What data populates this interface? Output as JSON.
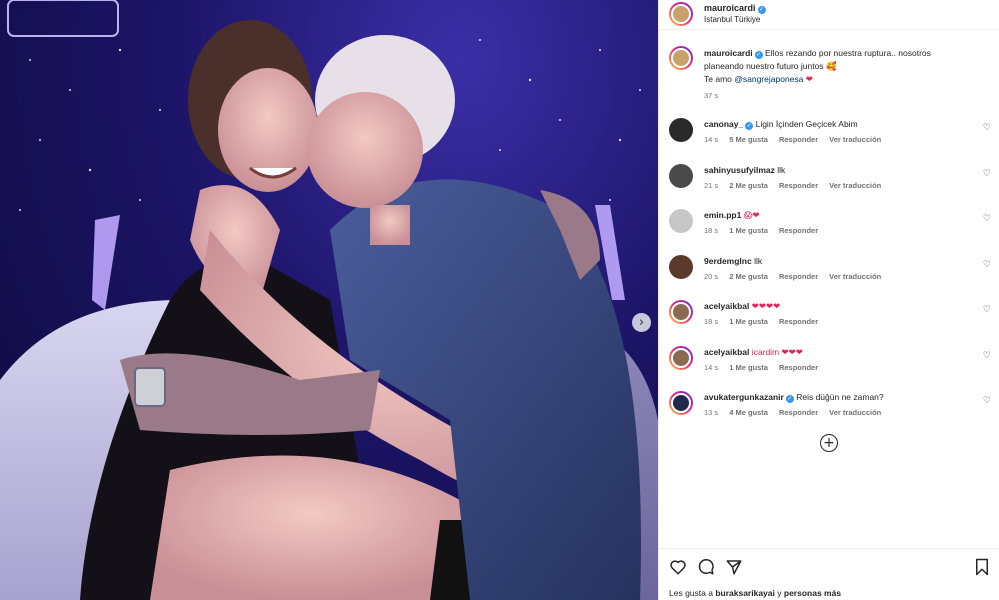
{
  "post": {
    "username": "mauroicardi",
    "location": "Istanbul Türkiye",
    "more_label": "•••",
    "caption": {
      "username": "mauroicardi",
      "text_line1": "Ellos rezando por nuestra ruptura.. nosotros",
      "text_line2": "planeando nuestro futuro juntos",
      "text_line3_prefix": "Te amo",
      "mention": "@sangrejaponesa",
      "emoji_line2": "🥰",
      "emoji_line3": "❤",
      "time": "37 s"
    }
  },
  "comments": [
    {
      "username": "canonay_",
      "verified": true,
      "text": "Ligin İçinden Geçicek Abim",
      "time": "14 s",
      "likes": "5 Me gusta",
      "reply": "Responder",
      "translate": "Ver traducción",
      "avatar_color": "#2a2a2a"
    },
    {
      "username": "sahinyusufyilmaz",
      "verified": false,
      "text": "llk",
      "time": "21 s",
      "likes": "2 Me gusta",
      "reply": "Responder",
      "translate": "Ver traducción",
      "avatar_color": "#4a4a4a"
    },
    {
      "username": "emin.pp1",
      "verified": false,
      "text": "😱❤",
      "time": "18 s",
      "likes": "1 Me gusta",
      "reply": "Responder",
      "translate": "",
      "avatar_color": "#c7c7c7"
    },
    {
      "username": "9erdemglnc",
      "verified": false,
      "text": "llk",
      "time": "20 s",
      "likes": "2 Me gusta",
      "reply": "Responder",
      "translate": "Ver traducción",
      "avatar_color": "#5a3a2a"
    },
    {
      "username": "acelyaikbal",
      "verified": false,
      "text": "❤❤❤❤",
      "time": "18 s",
      "likes": "1 Me gusta",
      "reply": "Responder",
      "translate": "",
      "avatar_color": "#8a6a50"
    },
    {
      "username": "acelyaikbal",
      "verified": false,
      "text": "icardim ❤❤❤",
      "time": "14 s",
      "likes": "1 Me gusta",
      "reply": "Responder",
      "translate": "",
      "avatar_color": "#8a6a50"
    },
    {
      "username": "avukatergunkazanir",
      "verified": true,
      "text": "Reis düğün ne zaman?",
      "time": "13 s",
      "likes": "4 Me gusta",
      "reply": "Responder",
      "translate": "Ver traducción",
      "avatar_color": "#1e2a4a"
    }
  ],
  "load_more_label": "+",
  "likes_line": {
    "prefix": "Les gusta a",
    "user": "buraksarikayai",
    "mid": "y",
    "others": "personas más"
  },
  "colors": {
    "accent": "#3897f0",
    "heart_red": "#e0245e",
    "photo_bg": "#1c1466",
    "muted": "#737373"
  },
  "icons": [
    "heart-icon",
    "comment-icon",
    "share-icon",
    "bookmark-icon",
    "more-icon",
    "next-arrow-icon",
    "add-circle-icon",
    "verified-icon"
  ]
}
